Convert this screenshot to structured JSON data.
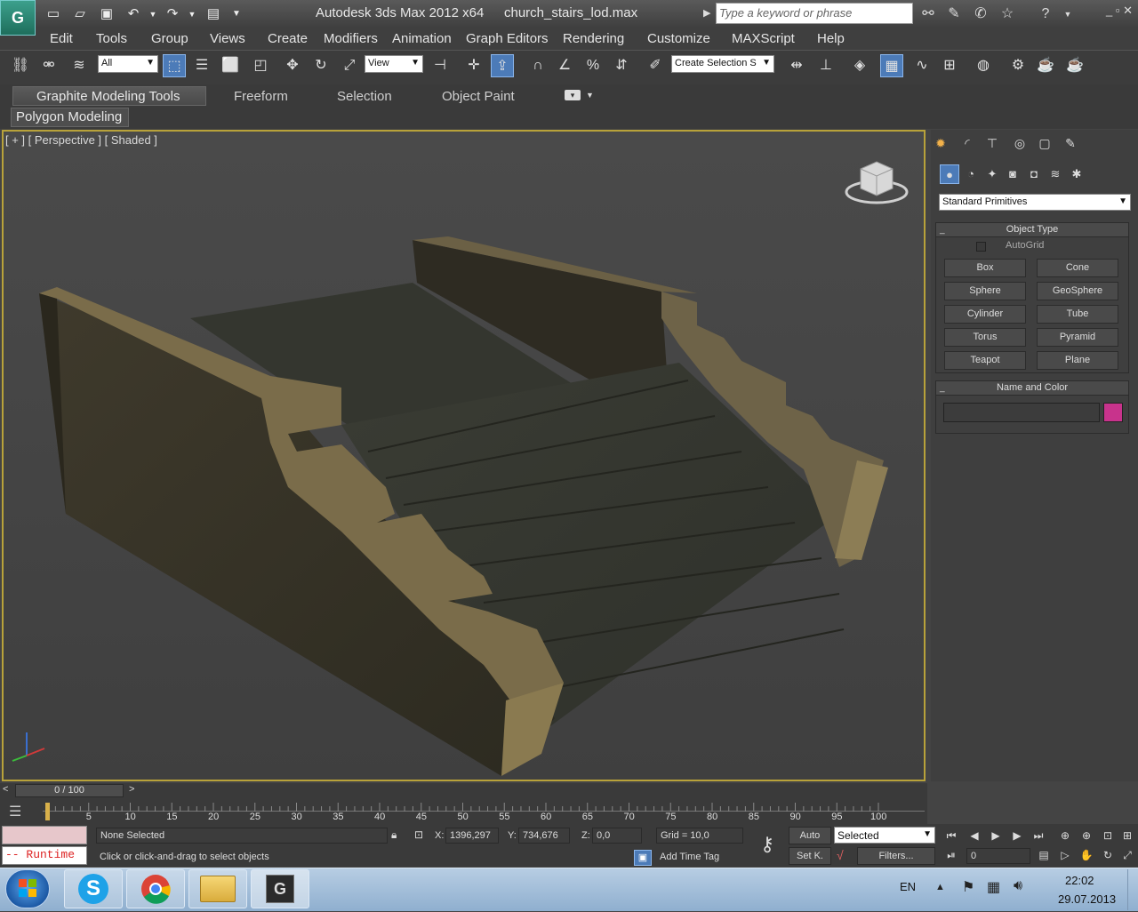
{
  "window": {
    "title": "Autodesk 3ds Max  2012 x64",
    "file": "church_stairs_lod.max",
    "search_placeholder": "Type a keyword or phrase",
    "controls": "_ ▫ ✕"
  },
  "menu": [
    "Edit",
    "Tools",
    "Group",
    "Views",
    "Create",
    "Modifiers",
    "Animation",
    "Graph Editors",
    "Rendering",
    "Customize",
    "MAXScript",
    "Help"
  ],
  "toolbar": {
    "selection_filter": "All",
    "ref_coord": "View",
    "named_selection": "Create Selection S"
  },
  "ribbon": {
    "tabs": [
      "Graphite Modeling Tools",
      "Freeform",
      "Selection",
      "Object Paint"
    ],
    "panel": "Polygon Modeling"
  },
  "viewport": {
    "label": "[ + ] [ Perspective ] [ Shaded ]"
  },
  "command_panel": {
    "category": "Standard Primitives",
    "object_type_title": "Object Type",
    "autogrid": "AutoGrid",
    "buttons": [
      "Box",
      "Cone",
      "Sphere",
      "GeoSphere",
      "Cylinder",
      "Tube",
      "Torus",
      "Pyramid",
      "Teapot",
      "Plane"
    ],
    "name_color_title": "Name and Color",
    "color": "#c8338c"
  },
  "timeline": {
    "frame": "0 / 100",
    "ticks": [
      "5",
      "10",
      "15",
      "20",
      "25",
      "30",
      "35",
      "40",
      "45",
      "50",
      "55",
      "60",
      "65",
      "70",
      "75",
      "80",
      "85",
      "90",
      "95",
      "100"
    ]
  },
  "status": {
    "runtime": "-- Runtime",
    "selection": "None Selected",
    "prompt": "Click or click-and-drag to select objects",
    "x_label": "X:",
    "x_value": "1396,297",
    "y_label": "Y:",
    "y_value": "734,676",
    "z_label": "Z:",
    "z_value": "0,0",
    "grid": "Grid = 10,0",
    "add_time_tag": "Add Time Tag",
    "auto": "Auto",
    "set_key": "Set K.",
    "key_filter": "Selected",
    "filters": "Filters...",
    "frame_field": "0"
  },
  "taskbar": {
    "lang": "EN",
    "time": "22:02",
    "date": "29.07.2013"
  }
}
